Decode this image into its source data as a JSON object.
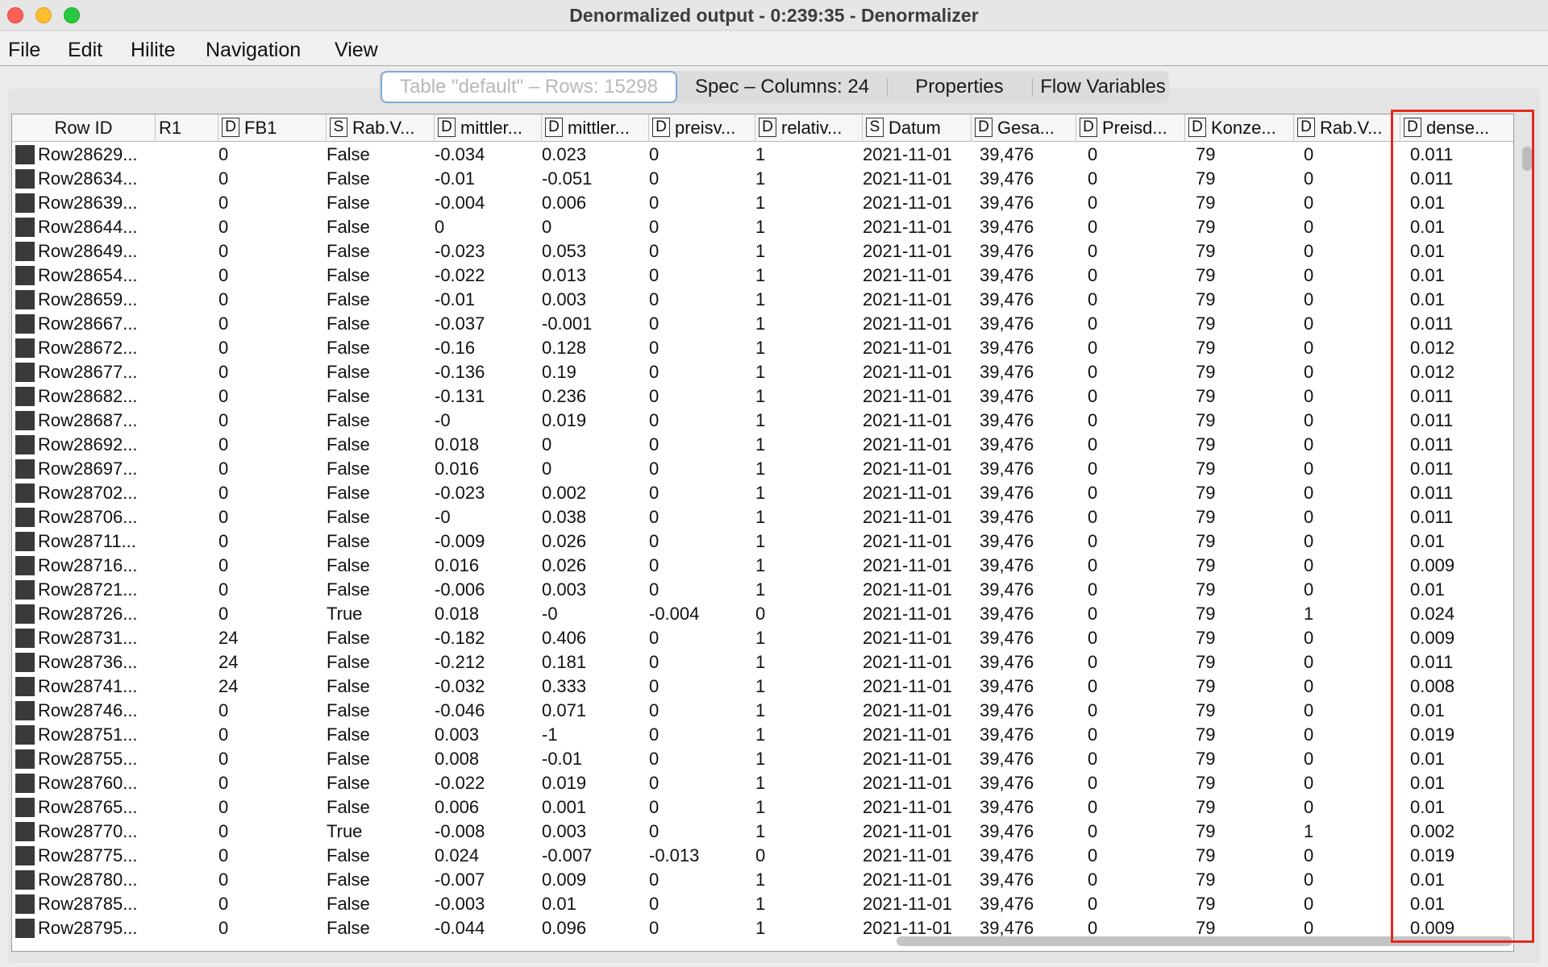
{
  "window": {
    "title": "Denormalized output - 0:239:35 - Denormalizer"
  },
  "menu": [
    "File",
    "Edit",
    "Hilite",
    "Navigation",
    "View"
  ],
  "tabs": [
    {
      "label": "Table \"default\" – Rows: 15298"
    },
    {
      "label": "Spec – Columns: 24"
    },
    {
      "label": "Properties"
    },
    {
      "label": "Flow Variables"
    }
  ],
  "columns": [
    {
      "label": "Row ID",
      "type": ""
    },
    {
      "label": "R1",
      "type": ""
    },
    {
      "label": "FB1",
      "type": "D"
    },
    {
      "label": "Rab.V...",
      "type": "S"
    },
    {
      "label": "mittler...",
      "type": "D"
    },
    {
      "label": "mittler...",
      "type": "D"
    },
    {
      "label": "preisv...",
      "type": "D"
    },
    {
      "label": "relativ...",
      "type": "D"
    },
    {
      "label": "Datum",
      "type": "S"
    },
    {
      "label": "Gesa...",
      "type": "D"
    },
    {
      "label": "Preisd...",
      "type": "D"
    },
    {
      "label": "Konze...",
      "type": "D"
    },
    {
      "label": "Rab.V...",
      "type": "D"
    },
    {
      "label": "dense...",
      "type": "D"
    }
  ],
  "rows": [
    [
      "Row28629...",
      "0",
      "False",
      "-0.034",
      "0.023",
      "0",
      "1",
      "2021-11-01",
      "39,476",
      "0",
      "79",
      "0",
      "0.011"
    ],
    [
      "Row28634...",
      "0",
      "False",
      "-0.01",
      "-0.051",
      "0",
      "1",
      "2021-11-01",
      "39,476",
      "0",
      "79",
      "0",
      "0.011"
    ],
    [
      "Row28639...",
      "0",
      "False",
      "-0.004",
      "0.006",
      "0",
      "1",
      "2021-11-01",
      "39,476",
      "0",
      "79",
      "0",
      "0.01"
    ],
    [
      "Row28644...",
      "0",
      "False",
      "0",
      "0",
      "0",
      "1",
      "2021-11-01",
      "39,476",
      "0",
      "79",
      "0",
      "0.01"
    ],
    [
      "Row28649...",
      "0",
      "False",
      "-0.023",
      "0.053",
      "0",
      "1",
      "2021-11-01",
      "39,476",
      "0",
      "79",
      "0",
      "0.01"
    ],
    [
      "Row28654...",
      "0",
      "False",
      "-0.022",
      "0.013",
      "0",
      "1",
      "2021-11-01",
      "39,476",
      "0",
      "79",
      "0",
      "0.01"
    ],
    [
      "Row28659...",
      "0",
      "False",
      "-0.01",
      "0.003",
      "0",
      "1",
      "2021-11-01",
      "39,476",
      "0",
      "79",
      "0",
      "0.01"
    ],
    [
      "Row28667...",
      "0",
      "False",
      "-0.037",
      "-0.001",
      "0",
      "1",
      "2021-11-01",
      "39,476",
      "0",
      "79",
      "0",
      "0.011"
    ],
    [
      "Row28672...",
      "0",
      "False",
      "-0.16",
      "0.128",
      "0",
      "1",
      "2021-11-01",
      "39,476",
      "0",
      "79",
      "0",
      "0.012"
    ],
    [
      "Row28677...",
      "0",
      "False",
      "-0.136",
      "0.19",
      "0",
      "1",
      "2021-11-01",
      "39,476",
      "0",
      "79",
      "0",
      "0.012"
    ],
    [
      "Row28682...",
      "0",
      "False",
      "-0.131",
      "0.236",
      "0",
      "1",
      "2021-11-01",
      "39,476",
      "0",
      "79",
      "0",
      "0.011"
    ],
    [
      "Row28687...",
      "0",
      "False",
      "-0",
      "0.019",
      "0",
      "1",
      "2021-11-01",
      "39,476",
      "0",
      "79",
      "0",
      "0.011"
    ],
    [
      "Row28692...",
      "0",
      "False",
      "0.018",
      "0",
      "0",
      "1",
      "2021-11-01",
      "39,476",
      "0",
      "79",
      "0",
      "0.011"
    ],
    [
      "Row28697...",
      "0",
      "False",
      "0.016",
      "0",
      "0",
      "1",
      "2021-11-01",
      "39,476",
      "0",
      "79",
      "0",
      "0.011"
    ],
    [
      "Row28702...",
      "0",
      "False",
      "-0.023",
      "0.002",
      "0",
      "1",
      "2021-11-01",
      "39,476",
      "0",
      "79",
      "0",
      "0.011"
    ],
    [
      "Row28706...",
      "0",
      "False",
      "-0",
      "0.038",
      "0",
      "1",
      "2021-11-01",
      "39,476",
      "0",
      "79",
      "0",
      "0.011"
    ],
    [
      "Row28711...",
      "0",
      "False",
      "-0.009",
      "0.026",
      "0",
      "1",
      "2021-11-01",
      "39,476",
      "0",
      "79",
      "0",
      "0.01"
    ],
    [
      "Row28716...",
      "0",
      "False",
      "0.016",
      "0.026",
      "0",
      "1",
      "2021-11-01",
      "39,476",
      "0",
      "79",
      "0",
      "0.009"
    ],
    [
      "Row28721...",
      "0",
      "False",
      "-0.006",
      "0.003",
      "0",
      "1",
      "2021-11-01",
      "39,476",
      "0",
      "79",
      "0",
      "0.01"
    ],
    [
      "Row28726...",
      "0",
      "True",
      "0.018",
      "-0",
      "-0.004",
      "0",
      "2021-11-01",
      "39,476",
      "0",
      "79",
      "1",
      "0.024"
    ],
    [
      "Row28731...",
      "24",
      "False",
      "-0.182",
      "0.406",
      "0",
      "1",
      "2021-11-01",
      "39,476",
      "0",
      "79",
      "0",
      "0.009"
    ],
    [
      "Row28736...",
      "24",
      "False",
      "-0.212",
      "0.181",
      "0",
      "1",
      "2021-11-01",
      "39,476",
      "0",
      "79",
      "0",
      "0.011"
    ],
    [
      "Row28741...",
      "24",
      "False",
      "-0.032",
      "0.333",
      "0",
      "1",
      "2021-11-01",
      "39,476",
      "0",
      "79",
      "0",
      "0.008"
    ],
    [
      "Row28746...",
      "0",
      "False",
      "-0.046",
      "0.071",
      "0",
      "1",
      "2021-11-01",
      "39,476",
      "0",
      "79",
      "0",
      "0.01"
    ],
    [
      "Row28751...",
      "0",
      "False",
      "0.003",
      "-1",
      "0",
      "1",
      "2021-11-01",
      "39,476",
      "0",
      "79",
      "0",
      "0.019"
    ],
    [
      "Row28755...",
      "0",
      "False",
      "0.008",
      "-0.01",
      "0",
      "1",
      "2021-11-01",
      "39,476",
      "0",
      "79",
      "0",
      "0.01"
    ],
    [
      "Row28760...",
      "0",
      "False",
      "-0.022",
      "0.019",
      "0",
      "1",
      "2021-11-01",
      "39,476",
      "0",
      "79",
      "0",
      "0.01"
    ],
    [
      "Row28765...",
      "0",
      "False",
      "0.006",
      "0.001",
      "0",
      "1",
      "2021-11-01",
      "39,476",
      "0",
      "79",
      "0",
      "0.01"
    ],
    [
      "Row28770...",
      "0",
      "True",
      "-0.008",
      "0.003",
      "0",
      "1",
      "2021-11-01",
      "39,476",
      "0",
      "79",
      "1",
      "0.002"
    ],
    [
      "Row28775...",
      "0",
      "False",
      "0.024",
      "-0.007",
      "-0.013",
      "0",
      "2021-11-01",
      "39,476",
      "0",
      "79",
      "0",
      "0.019"
    ],
    [
      "Row28780...",
      "0",
      "False",
      "-0.007",
      "0.009",
      "0",
      "1",
      "2021-11-01",
      "39,476",
      "0",
      "79",
      "0",
      "0.01"
    ],
    [
      "Row28785...",
      "0",
      "False",
      "-0.003",
      "0.01",
      "0",
      "1",
      "2021-11-01",
      "39,476",
      "0",
      "79",
      "0",
      "0.01"
    ],
    [
      "Row28795...",
      "0",
      "False",
      "-0.044",
      "0.096",
      "0",
      "1",
      "2021-11-01",
      "39,476",
      "0",
      "79",
      "0",
      "0.009"
    ]
  ],
  "colors": {
    "highlight_box": "#e12a1f",
    "active_tab_border": "#7da7d9"
  }
}
